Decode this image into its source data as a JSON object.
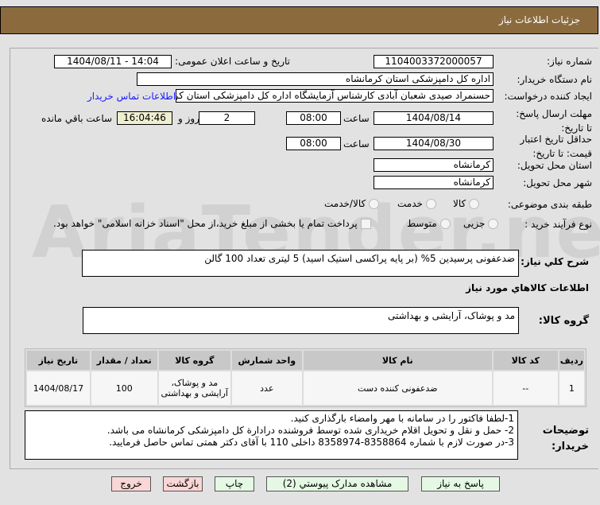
{
  "header": {
    "title": "جزئیات اطلاعات نیاز"
  },
  "watermark": "AriaTender.net",
  "form": {
    "need_number_label": "شماره نیاز:",
    "need_number": "1104003372000057",
    "announce_label": "تاریخ و ساعت اعلان عمومی:",
    "announce_value": "1404/08/11 - 14:04",
    "buyer_label": "نام دستگاه خریدار:",
    "buyer": "اداره کل دامپزشکی استان کرمانشاه",
    "creator_label": "ایجاد کننده درخواست:",
    "creator": "حسنمراد صیدی شعبان آبادی کارشناس آزمایشگاه اداره کل دامپزشکی استان کرمانشاه",
    "contact_link": "اطلاعات تماس خریدار",
    "deadline_label": "مهلت ارسال پاسخ: تا تاریخ:",
    "deadline_date": "1404/08/14",
    "time_label": "ساعت",
    "deadline_time": "08:00",
    "days": "2",
    "days_label": "روز و",
    "remaining": "16:04:46",
    "remaining_label": "ساعت باقي مانده",
    "validity_label": "حداقل تاریخ اعتبار قیمت: تا تاریخ:",
    "validity_date": "1404/08/30",
    "validity_time": "08:00",
    "province_label": "استان محل تحویل:",
    "province": "کرمانشاه",
    "city_label": "شهر محل تحویل:",
    "city": "کرمانشاه",
    "category_label": "طبقه بندی موضوعی:",
    "category_options": [
      "کالا",
      "خدمت",
      "کالا/خدمت"
    ],
    "category_selected": "کالا",
    "process_label": "نوع فرآیند خرید :",
    "process_options": [
      "جزیی",
      "متوسط"
    ],
    "process_selected": "جزیی",
    "payment_note": "پرداخت تمام یا بخشی از مبلغ خرید،از محل \"اسناد خزانه اسلامی\" خواهد بود."
  },
  "description": {
    "label": "شرح کلي نیاز:",
    "value": "ضدعفونی پرسیدین 5%  (بر پایه پراکسی استیک اسید)  5 لیتری تعداد 100 گالن"
  },
  "goods_section_title": "اطلاعات کالاهاي مورد نیاز",
  "goods_group": {
    "label": "گروه کالا:",
    "value": "مد و پوشاک، آرایشی و بهداشتی"
  },
  "table": {
    "headers": [
      "ردیف",
      "کد کالا",
      "نام کالا",
      "واحد شمارش",
      "گروه کالا",
      "تعداد / مقدار",
      "تاریخ نیاز"
    ],
    "rows": [
      [
        "1",
        "--",
        "ضدعفونی کننده دست",
        "عدد",
        "مد و پوشاک، آرایشی و بهداشتی",
        "100",
        "1404/08/17"
      ]
    ]
  },
  "notes": {
    "label": "توضیحات خریدار:",
    "lines": [
      "1-لطفا فاکتور را در سامانه با مهر وامضاء بارگذاری کنید.",
      "2-  حمل و نقل و تحویل اقلام خریداری شده توسط فروشنده  درادارة کل دامپزشکی کرمانشاه می باشد.",
      "3-در صورت لازم با شماره 8358864-8358974 داخلی 110 با آقای دکتر همتی تماس حاصل فرمایید."
    ]
  },
  "buttons": {
    "reply": "پاسخ به نیاز",
    "attachments": "مشاهده مدارک پیوستي (2)",
    "print": "چاپ",
    "back": "بازگشت",
    "exit": "خروج"
  }
}
